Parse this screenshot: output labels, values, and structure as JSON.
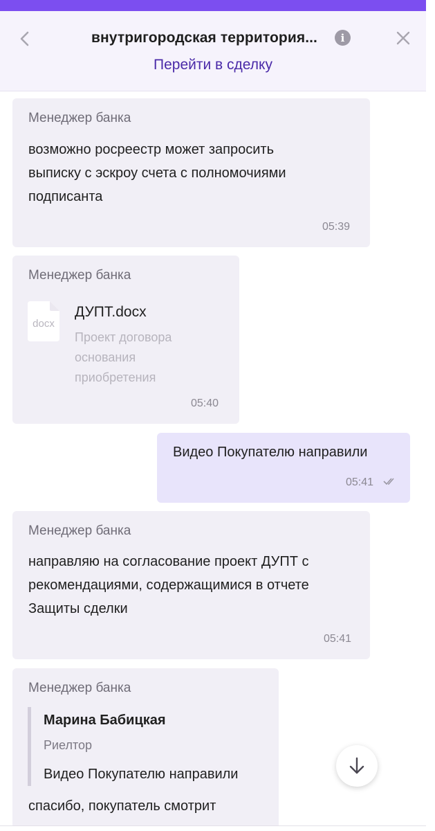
{
  "header": {
    "title": "внутригородская территория...",
    "deal_link": "Перейти в сделку",
    "back_icon": "chevron-left-icon",
    "info_icon": "info-icon",
    "info_glyph": "i",
    "close_icon": "close-icon"
  },
  "colors": {
    "accent": "#7c4ef0",
    "link": "#4a2aa8",
    "incoming_bubble": "#f1eff6",
    "outgoing_bubble": "#e8e4fb"
  },
  "messages": [
    {
      "sender": "Менеджер банка",
      "lines": [
        "возможно росреестр может запросить",
        "выписку с эскроу счета с полномочиями",
        "подписанта"
      ],
      "time": "05:39"
    },
    {
      "sender": "Менеджер банка",
      "file": {
        "icon_label": "docx",
        "name": "ДУПТ.docx",
        "description_lines": [
          "Проект договора",
          "основания",
          "приобретения"
        ]
      },
      "time": "05:40"
    },
    {
      "outgoing": true,
      "text": "Видео Покупателю направили",
      "time": "05:41",
      "status_icon": "double-check-icon"
    },
    {
      "sender": "Менеджер банка",
      "lines": [
        "направляю на согласование проект ДУПТ с",
        "рекомендациями, содержащимися в отчете",
        "Защиты сделки"
      ],
      "time": "05:41"
    },
    {
      "sender": "Менеджер банка",
      "quote": {
        "name": "Марина Бабицкая",
        "role": "Риелтор",
        "text": "Видео Покупателю направили"
      },
      "text": "спасибо, покупатель смотрит"
    }
  ],
  "scroll_button": {
    "icon": "arrow-down-icon"
  }
}
